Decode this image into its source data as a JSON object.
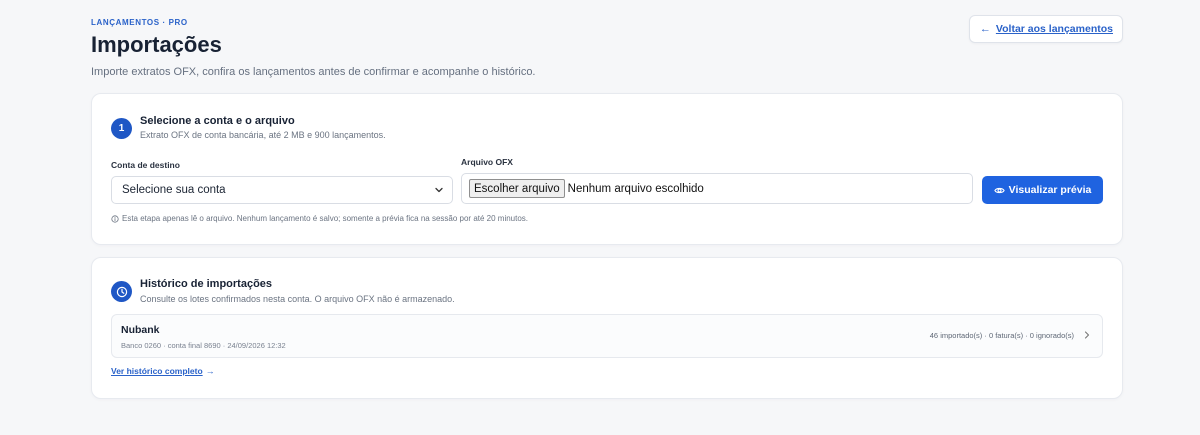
{
  "header": {
    "eyebrow": "LANÇAMENTOS · PRO",
    "title": "Importações",
    "subtitle": "Importe extratos OFX, confira os lançamentos antes de confirmar e acompanhe o histórico.",
    "back_arrow": "←",
    "back_label": "Voltar aos lançamentos"
  },
  "import_card": {
    "step_number": "1",
    "title": "Selecione a conta e o arquivo",
    "description": "Extrato OFX de conta bancária, até 2 MB e 900 lançamentos.",
    "account_label": "Conta de destino",
    "account_value": "Selecione sua conta",
    "file_label": "Arquivo OFX",
    "file_button": "Escolher arquivo",
    "file_status": "Nenhum arquivo escolhido",
    "preview_label": "Visualizar prévia",
    "note": "Esta etapa apenas lê o arquivo. Nenhum lançamento é salvo; somente a prévia fica na sessão por até 20 minutos."
  },
  "history_card": {
    "title": "Histórico de importações",
    "description": "Consulte os lotes confirmados nesta conta. O arquivo OFX não é armazenado.",
    "rows": [
      {
        "bank": "Nubank",
        "meta": "Banco 0260 · conta final 8690 · 24/09/2026 12:32",
        "counts": "46 importado(s) · 0 fatura(s) · 0 ignorado(s)"
      }
    ],
    "full_history_label": "Ver histórico completo",
    "full_history_arrow": "→"
  },
  "colors": {
    "accent": "#2a62c9",
    "primary_button": "#1f63e0",
    "badge": "#1f57c5"
  },
  "icons": {
    "back": "arrow-left-icon",
    "select": "chevron-down-icon",
    "preview": "eye-icon",
    "note": "info-icon",
    "history": "clock-icon",
    "row": "chevron-right-icon",
    "full_history": "arrow-right-icon"
  }
}
